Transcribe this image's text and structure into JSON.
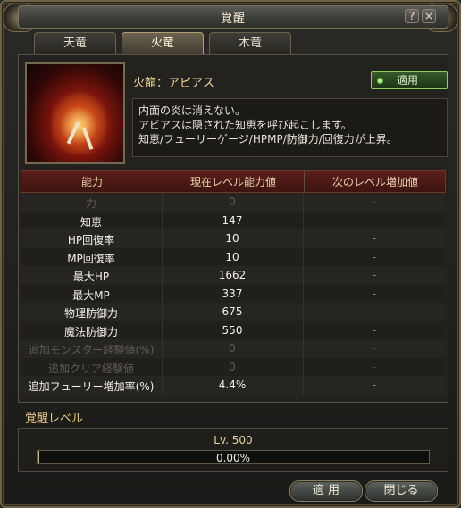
{
  "window": {
    "title": "覚醒",
    "help_label": "?",
    "close_label": "×"
  },
  "tabs": [
    {
      "label": "天竜",
      "active": false
    },
    {
      "label": "火竜",
      "active": true
    },
    {
      "label": "木竜",
      "active": false
    }
  ],
  "dragon": {
    "name": "火龍：アビアス",
    "apply_toggle_label": "適用",
    "description": [
      "内面の炎は消えない。",
      "アビアスは隠された知恵を呼び起こします。",
      "知恵/フューリーゲージ/HPMP/防御力/回復力が上昇。"
    ]
  },
  "table": {
    "headers": [
      "能力",
      "現在レベル能力値",
      "次のレベル増加値"
    ],
    "rows": [
      {
        "name": "力",
        "current": "0",
        "next": "-",
        "dim": true
      },
      {
        "name": "知恵",
        "current": "147",
        "next": "-",
        "dim": false
      },
      {
        "name": "HP回復率",
        "current": "10",
        "next": "-",
        "dim": false
      },
      {
        "name": "MP回復率",
        "current": "10",
        "next": "-",
        "dim": false
      },
      {
        "name": "最大HP",
        "current": "1662",
        "next": "-",
        "dim": false
      },
      {
        "name": "最大MP",
        "current": "337",
        "next": "-",
        "dim": false
      },
      {
        "name": "物理防御力",
        "current": "675",
        "next": "-",
        "dim": false
      },
      {
        "name": "魔法防御力",
        "current": "550",
        "next": "-",
        "dim": false
      },
      {
        "name": "追加モンスター経験値(%)",
        "current": "0",
        "next": "-",
        "dim": true
      },
      {
        "name": "追加クリア経験値",
        "current": "0",
        "next": "-",
        "dim": true
      },
      {
        "name": "追加フューリー増加率(%)",
        "current": "4.4%",
        "next": "-",
        "dim": false
      }
    ]
  },
  "awakening": {
    "section_label": "覚醒レベル",
    "level_text": "Lv. 500",
    "progress_text": "0.00%",
    "progress_fraction": 0.0
  },
  "buttons": {
    "apply_label": "適 用",
    "close_label": "閉じる"
  },
  "colors": {
    "accent": "#e6c98a",
    "header_red": "#5c1f1a",
    "toggle_green": "#8fd05e"
  }
}
